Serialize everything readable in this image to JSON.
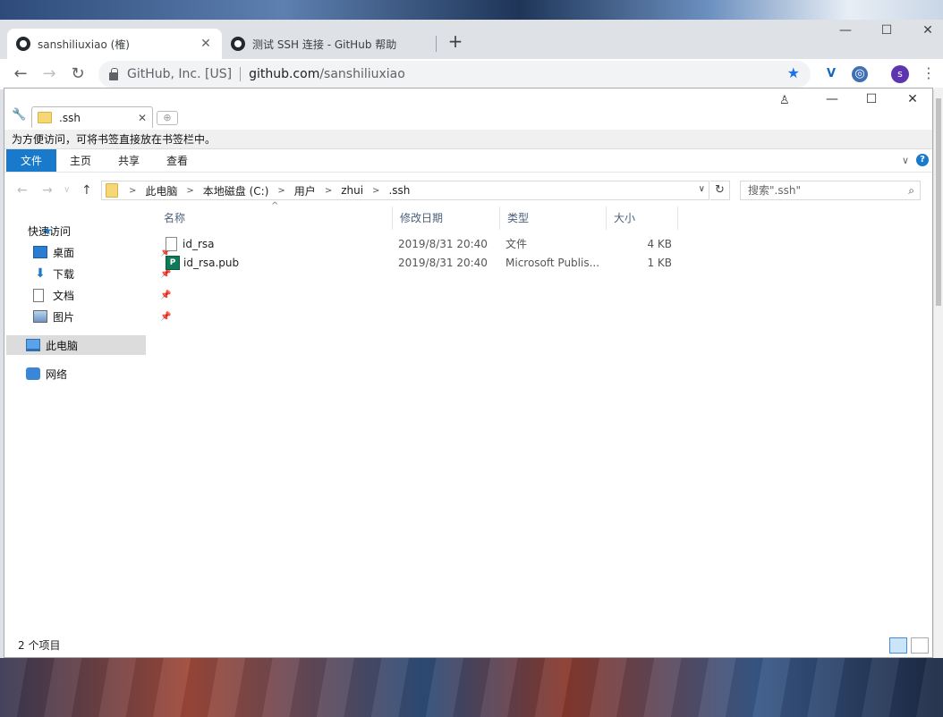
{
  "browser": {
    "tabs": [
      {
        "title": "sanshiliuxiao (榷)",
        "active": true
      },
      {
        "title": "测试 SSH 连接 - GitHub 帮助",
        "active": false
      }
    ],
    "new_tab": "+",
    "window_controls": {
      "min": "—",
      "max": "☐",
      "close": "✕"
    },
    "omnibox": {
      "site_identity": "GitHub, Inc. [US]",
      "url_host": "github.com",
      "url_path": "/sanshiliuxiao"
    },
    "avatar_letter": "s",
    "accent": "#1a73e8"
  },
  "explorer": {
    "tab_label": ".ssh",
    "bookmark_hint": "为方便访问，可将书签直接放在书签栏中。",
    "ribbon_tabs": [
      "文件",
      "主页",
      "共享",
      "查看"
    ],
    "breadcrumb": [
      "此电脑",
      "本地磁盘 (C:)",
      "用户",
      "zhui",
      ".ssh"
    ],
    "search_placeholder": "搜索\".ssh\"",
    "nav": {
      "quick_access": "快速访问",
      "pinned": [
        "桌面",
        "下载",
        "文档",
        "图片"
      ],
      "this_pc": "此电脑",
      "network": "网络"
    },
    "columns": [
      "名称",
      "修改日期",
      "类型",
      "大小"
    ],
    "files": [
      {
        "name": "id_rsa",
        "date": "2019/8/31 20:40",
        "type": "文件",
        "size": "4 KB",
        "icon": "blank-file-icon"
      },
      {
        "name": "id_rsa.pub",
        "date": "2019/8/31 20:40",
        "type": "Microsoft Publis...",
        "size": "1 KB",
        "icon": "publisher-file-icon"
      }
    ],
    "status": "2 个项目",
    "file_tab_color": "#1979ca"
  }
}
